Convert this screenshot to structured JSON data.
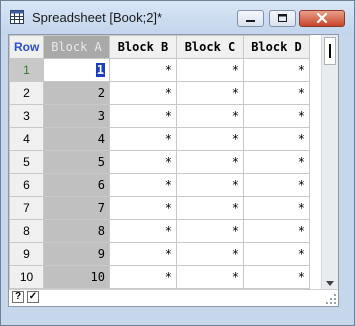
{
  "window": {
    "title": "Spreadsheet [Book;2]*"
  },
  "grid": {
    "corner_label": "Row",
    "columns": [
      "Block A",
      "Block B",
      "Block C",
      "Block D"
    ],
    "active_row": 1,
    "rows": [
      {
        "row": "1",
        "cells": [
          "1",
          "*",
          "*",
          "*"
        ]
      },
      {
        "row": "2",
        "cells": [
          "2",
          "*",
          "*",
          "*"
        ]
      },
      {
        "row": "3",
        "cells": [
          "3",
          "*",
          "*",
          "*"
        ]
      },
      {
        "row": "4",
        "cells": [
          "4",
          "*",
          "*",
          "*"
        ]
      },
      {
        "row": "5",
        "cells": [
          "5",
          "*",
          "*",
          "*"
        ]
      },
      {
        "row": "6",
        "cells": [
          "6",
          "*",
          "*",
          "*"
        ]
      },
      {
        "row": "7",
        "cells": [
          "7",
          "*",
          "*",
          "*"
        ]
      },
      {
        "row": "8",
        "cells": [
          "8",
          "*",
          "*",
          "*"
        ]
      },
      {
        "row": "9",
        "cells": [
          "9",
          "*",
          "*",
          "*"
        ]
      },
      {
        "row": "10",
        "cells": [
          "10",
          "*",
          "*",
          "*"
        ]
      }
    ]
  },
  "statusbar": {
    "help_glyph": "?",
    "check_glyph": "✓"
  },
  "icons": {
    "app": "spreadsheet-icon",
    "minimize": "minimize-icon",
    "maximize": "maximize-icon",
    "close": "close-icon"
  },
  "colors": {
    "accent_header": "#2c4ec8",
    "selected_column": "#c0c0c0",
    "cursor": "#1c3fbf",
    "active_row_label": "#2e7d2e"
  }
}
